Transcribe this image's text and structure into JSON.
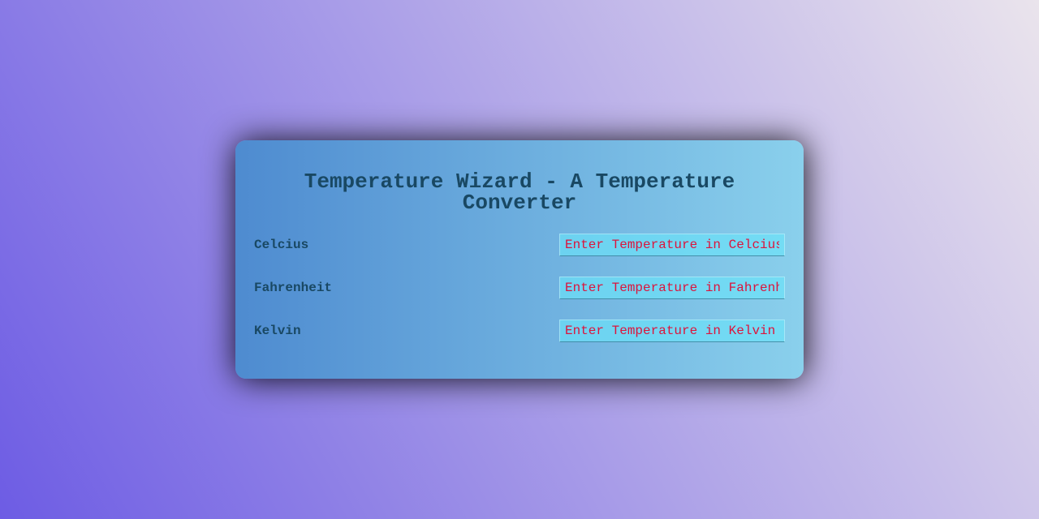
{
  "header": {
    "title": "Temperature Wizard - A Temperature Converter"
  },
  "fields": {
    "celcius": {
      "label": "Celcius",
      "placeholder": "Enter Temperature in Celcius",
      "value": ""
    },
    "fahrenheit": {
      "label": "Fahrenheit",
      "placeholder": "Enter Temperature in Fahrenheit",
      "value": ""
    },
    "kelvin": {
      "label": "Kelvin",
      "placeholder": "Enter Temperature in Kelvin",
      "value": ""
    }
  }
}
